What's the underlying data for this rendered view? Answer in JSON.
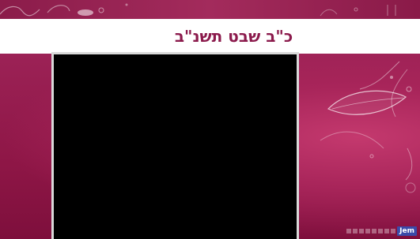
{
  "header": {
    "title": "כ\"ב שבט תשנ\"ב"
  },
  "video": {
    "state": "empty"
  },
  "branding": {
    "logo_text": "Jem",
    "accent_color": "#8b1a4c",
    "background_color": "#8e1646",
    "logo_color": "#3b4aa8"
  }
}
